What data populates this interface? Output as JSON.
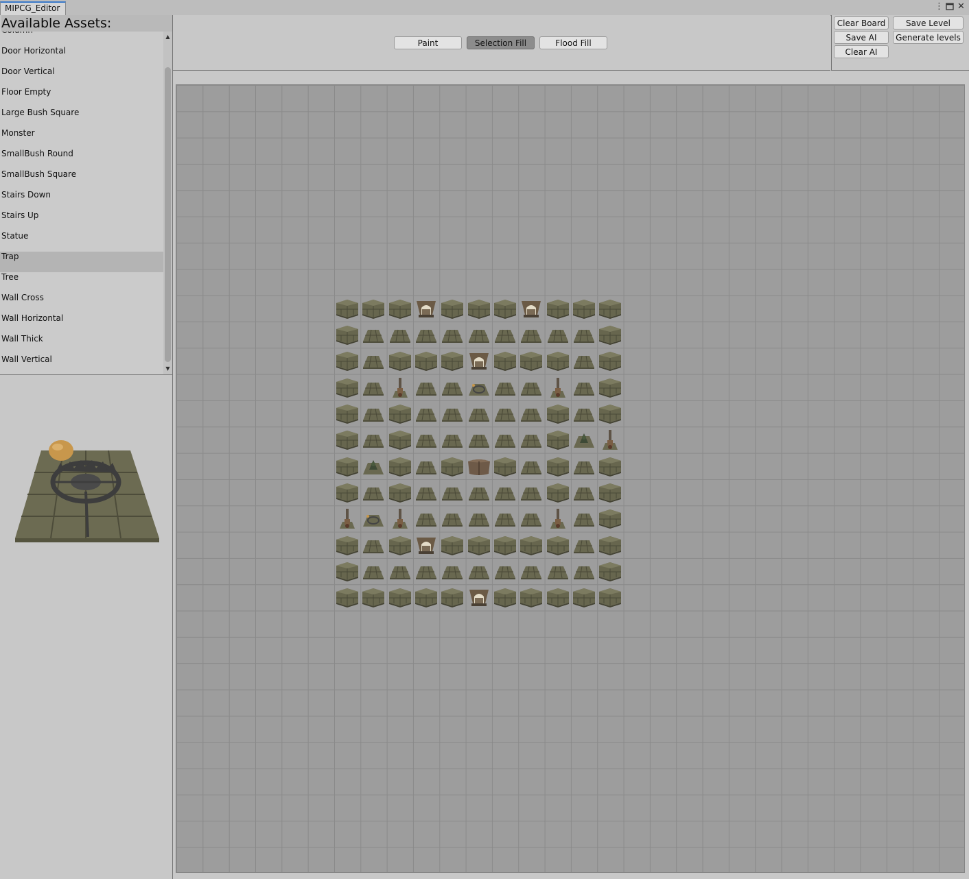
{
  "window": {
    "tab_title": "MIPCG_Editor",
    "more_icon": "kebab-menu-icon",
    "maximize_icon": "maximize-icon",
    "close_icon": "close-icon"
  },
  "assets_panel": {
    "title": "Available Assets:",
    "partial_item": "Column",
    "items": [
      "Door Horizontal",
      "Door Vertical",
      "Floor Empty",
      "Large Bush Square",
      "Monster",
      "SmallBush Round",
      "SmallBush Square",
      "Stairs Down",
      "Stairs Up",
      "Statue",
      "Trap",
      "Tree",
      "Wall Cross",
      "Wall Horizontal",
      "Wall Thick",
      "Wall Vertical"
    ],
    "selected_item": "Trap",
    "preview_asset": "Trap"
  },
  "toolbar": {
    "modes": [
      {
        "label": "Paint",
        "active": false
      },
      {
        "label": "Selection Fill",
        "active": true
      },
      {
        "label": "Flood Fill",
        "active": false
      }
    ]
  },
  "actions": {
    "clear_board": "Clear Board",
    "save_ai": "Save AI",
    "clear_ai": "Clear AI",
    "save_level": "Save Level",
    "generate_levels": "Generate levels"
  },
  "board": {
    "columns": 30,
    "rows": 30,
    "occupied_col_start": 6,
    "occupied_row_start": 8,
    "legend": {
      "W": "wall",
      "F": "floor",
      "D": "door",
      "T": "torch",
      "S": "spike trap",
      "B": "bush",
      "C": "chest"
    },
    "layout": [
      "WWWDWWWDWWW",
      "WFFFFFFFFFW",
      "WFWWWDWWWFW",
      "WFTFFSFFTFW",
      "WFWFFFFFWFW",
      "WFWFFFFFWBT",
      "WBWFWCWFWFW",
      "WFWFFFFFWFW",
      "TSTFFFFFTFW",
      "WFWDWWWWWFW",
      "WFFFFFFFFFW",
      "WWWWWDWWWWW"
    ]
  }
}
